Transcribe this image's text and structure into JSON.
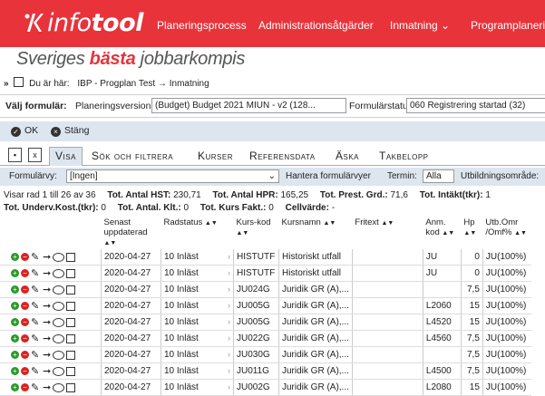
{
  "header": {
    "logo_text_light": "info",
    "logo_text_bold": "tool",
    "nav": [
      "Planeringsprocess",
      "Administrationsåtgärder",
      "Inmatning ⌄",
      "Programplanering"
    ]
  },
  "tagline": {
    "pre": "Sveriges ",
    "accent": "bästa",
    "post": " jobbarkompis"
  },
  "breadcrumb": {
    "label": "Du är här:",
    "path": "IBP - Progplan Test → Inmatning"
  },
  "form": {
    "title": "Välj formulär:",
    "version_label": "Planeringsversion:",
    "version_value": "(Budget) Budget 2021 MIUN - v2 (128...",
    "status_label": "Formulärstatus:",
    "status_value": "060 Registrering startad (32)"
  },
  "actions": {
    "ok": "OK",
    "close": "Stäng"
  },
  "tabs": [
    "Visa",
    "Sök och filtrera",
    "Kurser",
    "Referensdata",
    "Äska",
    "Takbelopp"
  ],
  "filterbar": {
    "view_label": "Formulärvy:",
    "view_value": "[Ingen]",
    "manage": "Hantera formulärvyer",
    "term_label": "Termin:",
    "term_value": "Alla",
    "area_label": "Utbildningsområde:"
  },
  "summary": {
    "rows": "Visar rad 1 till 26 av 36",
    "hst_label": "Tot. Antal HST:",
    "hst": "230,71",
    "hpr_label": "Tot. Antal HPR:",
    "hpr": "165,25",
    "prest_label": "Tot. Prest. Grd.:",
    "prest": "71,6",
    "intakt_label": "Tot. Intäkt(tkr):",
    "intakt": "1",
    "underv_label": "Tot. Underv.Kost.(tkr):",
    "underv": "0",
    "klt_label": "Tot. Antal. Klt.:",
    "klt": "0",
    "fakt_label": "Tot. Kurs Fakt.:",
    "fakt": "0",
    "cell_label": "Cellvärde:",
    "cell": "-"
  },
  "table": {
    "headers": [
      "Senast uppdaterad",
      "Radstatus",
      "Kurs-kod",
      "Kursnamn",
      "Fritext",
      "Anm. kod",
      "Hp",
      "Utb.Omr /Omf%"
    ],
    "rows": [
      [
        "2020-04-27",
        "10 Inläst",
        "HISTUTF",
        "Historiskt utfall",
        "",
        "JU",
        "0",
        "JU(100%)"
      ],
      [
        "2020-04-27",
        "10 Inläst",
        "HISTUTF",
        "Historiskt utfall",
        "",
        "JU",
        "0",
        "JU(100%)"
      ],
      [
        "2020-04-27",
        "10 Inläst",
        "JU024G",
        "Juridik GR (A),...",
        "",
        "",
        "7,5",
        "JU(100%)"
      ],
      [
        "2020-04-27",
        "10 Inläst",
        "JU005G",
        "Juridik GR (A),...",
        "",
        "L2060",
        "15",
        "JU(100%)"
      ],
      [
        "2020-04-27",
        "10 Inläst",
        "JU005G",
        "Juridik GR (A),...",
        "",
        "L4520",
        "15",
        "JU(100%)"
      ],
      [
        "2020-04-27",
        "10 Inläst",
        "JU022G",
        "Juridik GR (A),...",
        "",
        "L4560",
        "7,5",
        "JU(100%)"
      ],
      [
        "2020-04-27",
        "10 Inläst",
        "JU030G",
        "Juridik GR (A),...",
        "",
        "",
        "7,5",
        "JU(100%)"
      ],
      [
        "2020-04-27",
        "10 Inläst",
        "JU011G",
        "Juridik GR (A),...",
        "",
        "L4500",
        "7,5",
        "JU(100%)"
      ],
      [
        "2020-04-27",
        "10 Inläst",
        "JU002G",
        "Juridik GR (A),...",
        "",
        "L2080",
        "15",
        "JU(100%)"
      ]
    ]
  }
}
